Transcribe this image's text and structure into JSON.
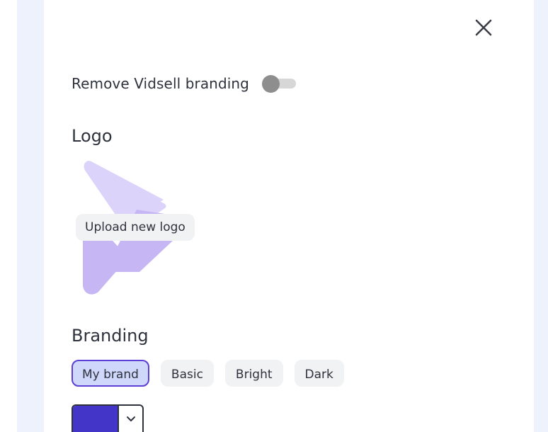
{
  "settings": {
    "remove_branding_label": "Remove Vidsell branding",
    "remove_branding_on": false
  },
  "logo": {
    "title": "Logo",
    "upload_label": "Upload new logo"
  },
  "branding": {
    "title": "Branding",
    "tabs": [
      {
        "label": "My brand",
        "active": true
      },
      {
        "label": "Basic",
        "active": false
      },
      {
        "label": "Bright",
        "active": false
      },
      {
        "label": "Dark",
        "active": false
      }
    ],
    "brand_color": "#4335c7"
  },
  "icons": {
    "close": "close-icon",
    "chevron": "chevron-down-icon",
    "logo": "vidsell-logo"
  },
  "colors": {
    "logo_light": "#dcd3fb",
    "logo_mid": "#c6b6f3",
    "active_tab_bg": "#cfd8fb",
    "active_tab_border": "#5b3fd6",
    "toggle_off_knob": "#8e8e8e"
  }
}
